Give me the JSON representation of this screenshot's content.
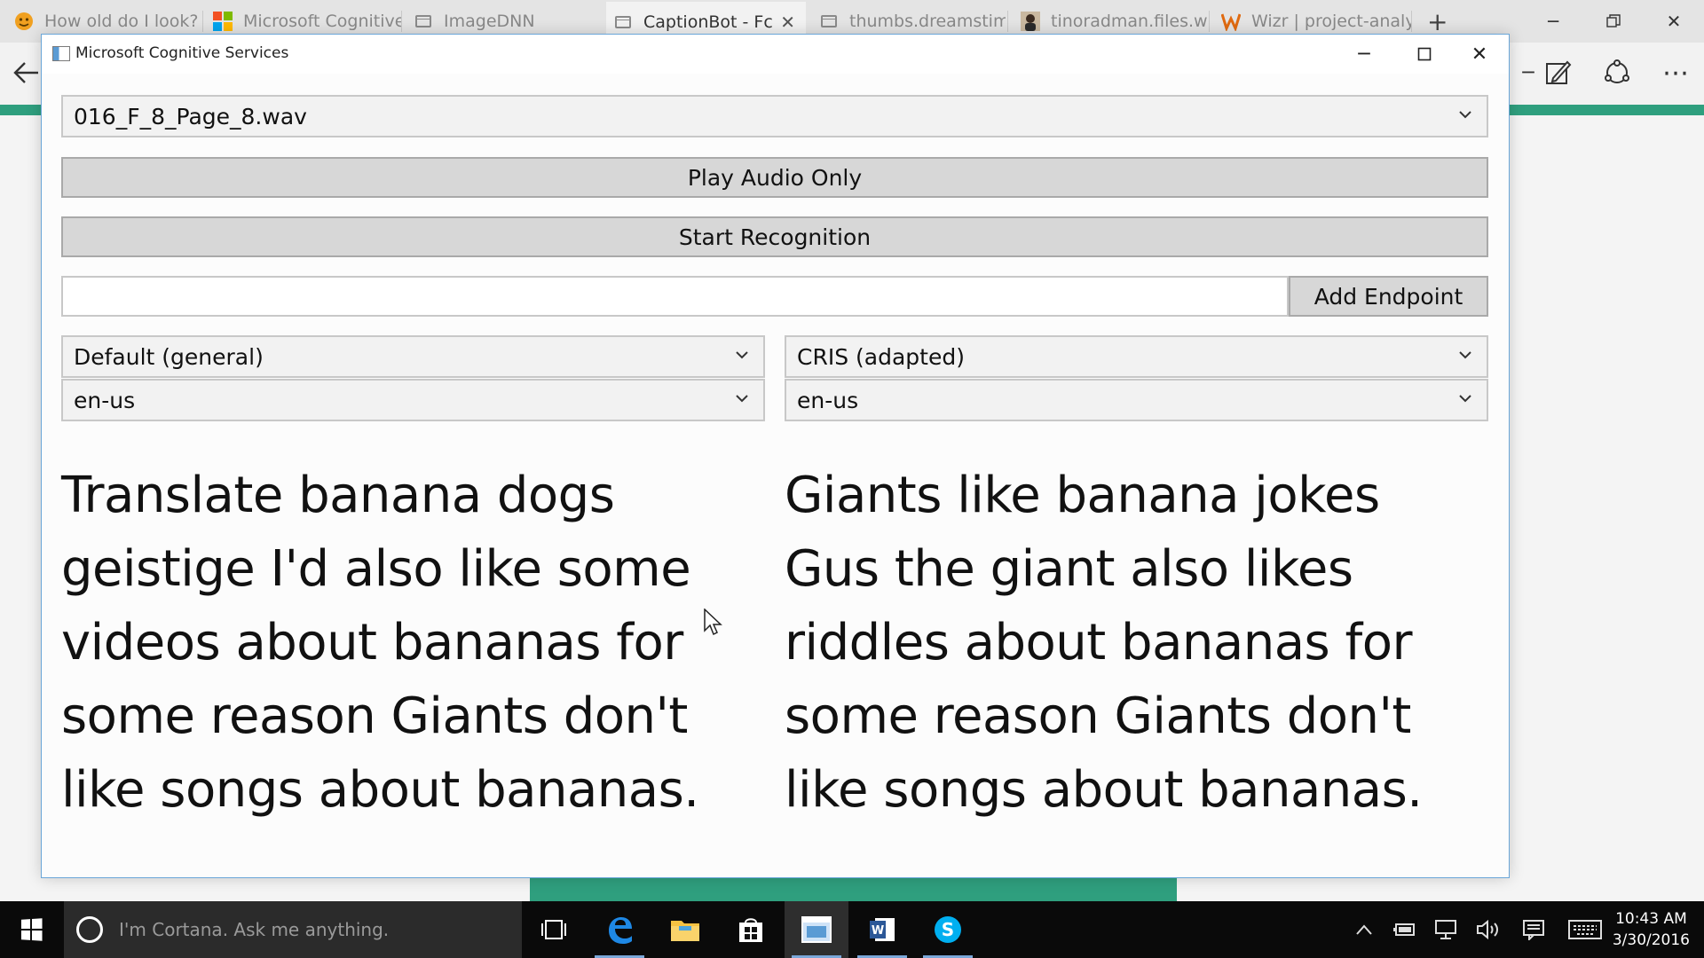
{
  "browser": {
    "tabs": [
      {
        "label": "How old do I look?",
        "icon": "face-icon"
      },
      {
        "label": "Microsoft Cognitive",
        "icon": "microsoft-logo-icon"
      },
      {
        "label": "ImageDNN",
        "icon": "page-icon"
      },
      {
        "label": "CaptionBot - Fc",
        "icon": "page-icon",
        "active": true
      },
      {
        "label": "thumbs.dreamstime",
        "icon": "page-icon"
      },
      {
        "label": "tinoradman.files.wc",
        "icon": "person-icon"
      },
      {
        "label": "Wizr | project-analy",
        "icon": "wizr-logo-icon"
      }
    ],
    "accent_color": "#2f9f7e"
  },
  "app": {
    "title": "Microsoft Cognitive Services",
    "file_select": {
      "value": "016_F_8_Page_8.wav"
    },
    "play_audio_label": "Play Audio Only",
    "start_recognition_label": "Start Recognition",
    "endpoint_input": {
      "value": "",
      "placeholder": ""
    },
    "add_endpoint_label": "Add Endpoint",
    "left": {
      "model": "Default (general)",
      "locale": "en-us",
      "transcript": "Translate banana dogs geistige I'd also like some videos about bananas for some reason Giants don't like songs about bananas."
    },
    "right": {
      "model": "CRIS (adapted)",
      "locale": "en-us",
      "transcript": "Giants like banana jokes Gus the giant also likes riddles about bananas for some reason Giants don't like songs about bananas."
    }
  },
  "taskbar": {
    "cortana_placeholder": "I'm Cortana. Ask me anything.",
    "clock_time": "10:43 AM",
    "clock_date": "3/30/2016"
  }
}
